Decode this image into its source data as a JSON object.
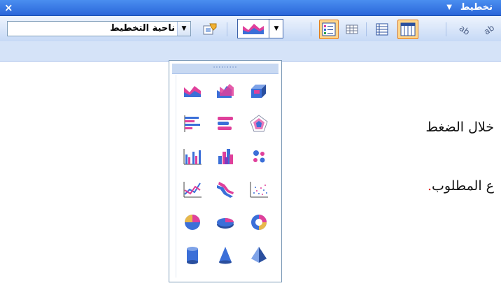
{
  "window": {
    "title": "تخطيط",
    "close_glyph": "×",
    "menu_arrow_glyph": "▼"
  },
  "toolbar": {
    "plot_area_combo": "ناحية التخطيط",
    "combo_arrow": "▼",
    "chart_type_arrow": "▼",
    "buttons": [
      {
        "name": "format-plot-area-button",
        "icon": "format-icon"
      },
      {
        "name": "chart-type-button",
        "icon": "area-chart-icon"
      },
      {
        "name": "legend-button",
        "icon": "legend-icon",
        "selected": true
      },
      {
        "name": "data-table-button",
        "icon": "data-table-icon"
      },
      {
        "name": "by-row-button",
        "icon": "by-row-icon"
      },
      {
        "name": "by-column-button",
        "icon": "by-column-icon",
        "selected": true
      },
      {
        "name": "angle-text-downward-button",
        "icon": "angle-down-text-icon"
      },
      {
        "name": "angle-text-upward-button",
        "icon": "angle-up-text-icon"
      }
    ]
  },
  "palette": {
    "grip_dots": "·········",
    "chart_types": [
      [
        "area",
        "area-3d",
        "column-stack-3d"
      ],
      [
        "bar",
        "bar-3d",
        "radar"
      ],
      [
        "column",
        "column-3d",
        "bubble"
      ],
      [
        "line",
        "line-3d",
        "scatter"
      ],
      [
        "pie",
        "pie-3d",
        "doughnut"
      ],
      [
        "cylinder",
        "cone",
        "pyramid"
      ]
    ]
  },
  "document": {
    "line1": "خلال الضغط",
    "line2": "ع المطلوب",
    "line2_end": "."
  },
  "colors": {
    "titlebar": "#2a66d9",
    "toolbar": "#d5e3f8",
    "selected_button": "#ffd58a",
    "chart_pink": "#e0409b",
    "chart_blue": "#3b6fd8"
  }
}
